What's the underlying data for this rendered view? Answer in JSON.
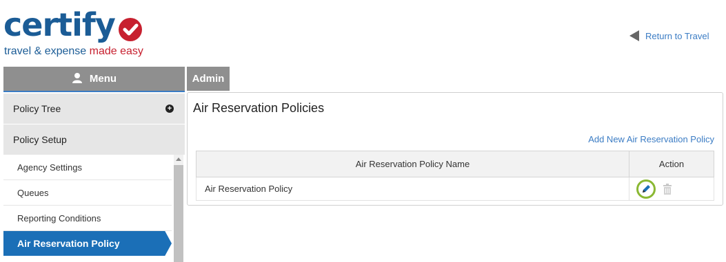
{
  "logo": {
    "word": "certify",
    "tagline_part1": "travel & expense ",
    "tagline_part2": "made easy",
    "brand_blue": "#1b5c96",
    "brand_red": "#c7202f"
  },
  "header": {
    "return_label": "Return to Travel",
    "return_icon": "left-arrow-icon"
  },
  "tabs": {
    "menu_label": "Menu",
    "menu_icon": "user-icon",
    "admin_label": "Admin"
  },
  "sidebar": {
    "sections": [
      {
        "label": "Policy Tree",
        "icon": "plus-circle-icon"
      },
      {
        "label": "Policy Setup"
      }
    ],
    "items": [
      {
        "label": "Agency Settings"
      },
      {
        "label": "Queues"
      },
      {
        "label": "Reporting Conditions"
      },
      {
        "label": "Air Reservation Policy",
        "active": true
      }
    ],
    "active_color": "#1b6fb7"
  },
  "main": {
    "title": "Air Reservation Policies",
    "add_link": "Add New Air Reservation Policy",
    "table": {
      "headers": [
        "Air Reservation Policy Name",
        "Action"
      ],
      "rows": [
        {
          "name": "Air Reservation Policy",
          "actions": [
            "edit-icon",
            "trash-icon"
          ]
        }
      ]
    },
    "highlight_color": "#8ab833"
  }
}
